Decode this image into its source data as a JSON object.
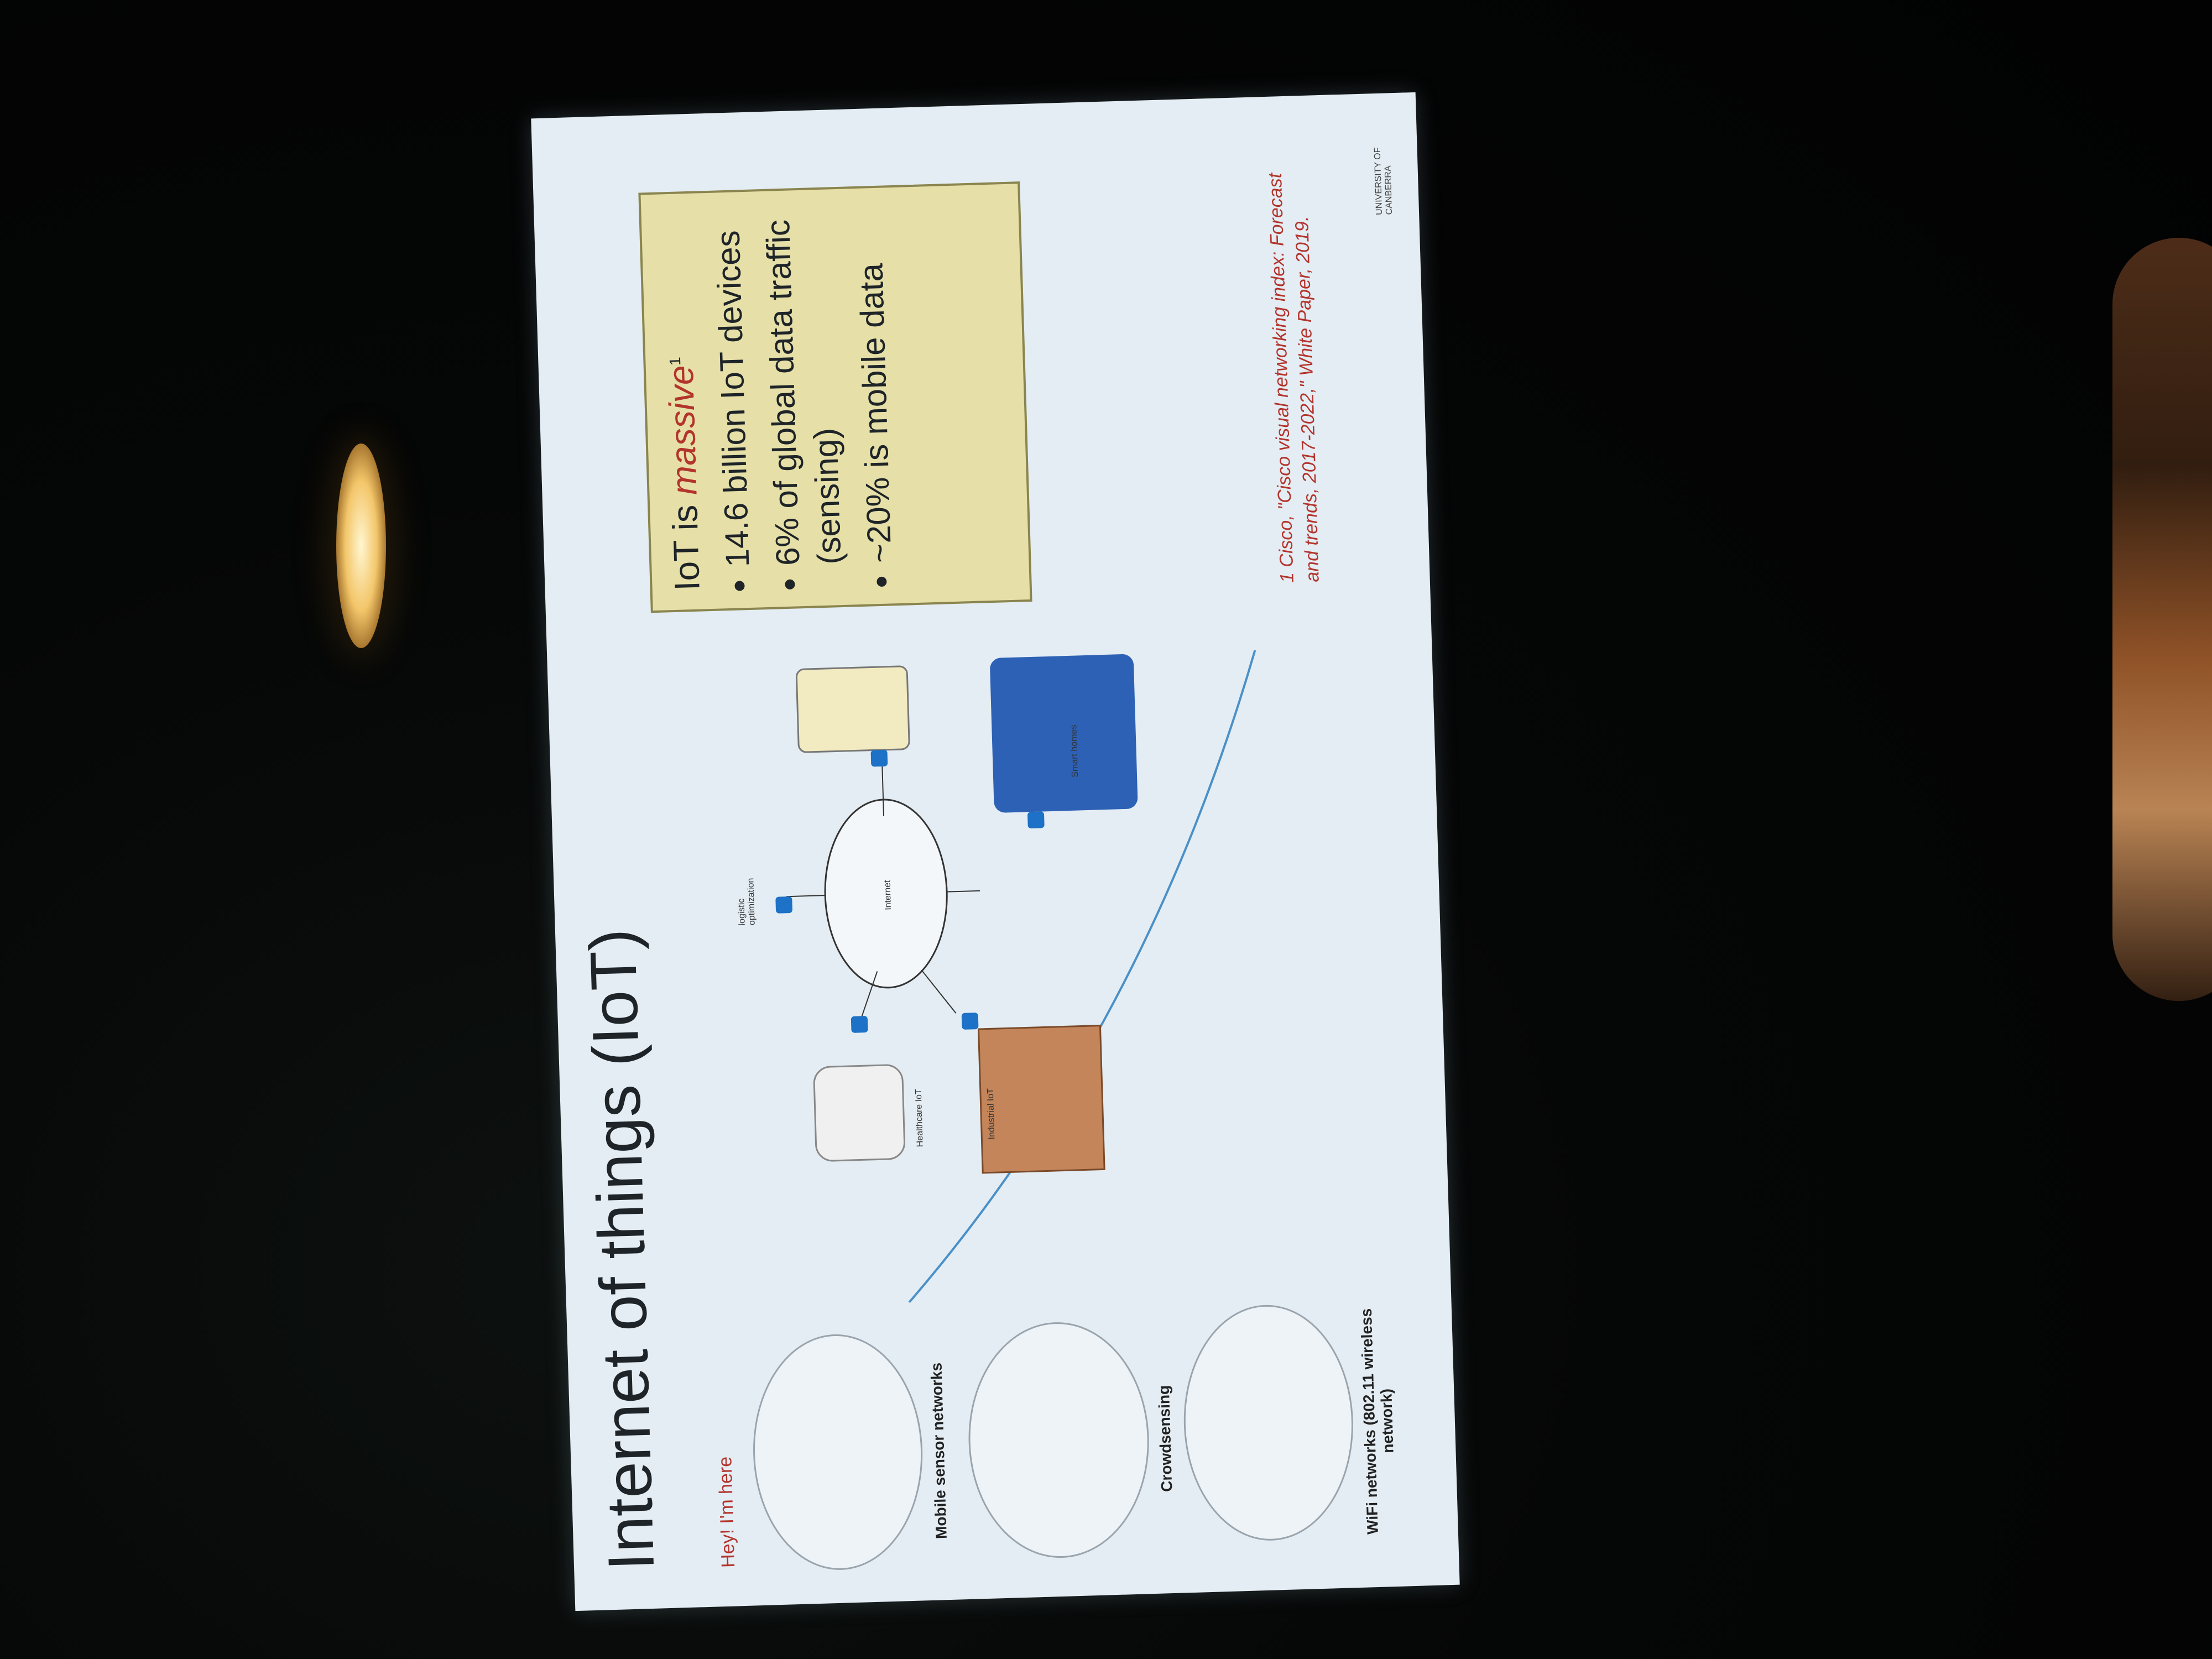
{
  "slide": {
    "title": "Internet of things (IoT)",
    "hey_text": "Hey! I'm here",
    "callout": {
      "heading_prefix": "IoT is ",
      "heading_emphasis": "massive",
      "heading_sup": "1",
      "bullets": [
        "14.6 billion IoT devices",
        "6% of global data traffic (sensing)",
        "~20% is mobile data"
      ]
    },
    "reference": "1 Cisco, \"Cisco visual networking index: Forecast and trends, 2017-2022,\" White Paper, 2019.",
    "diagram": {
      "mobile_sensor_networks": "Mobile sensor networks",
      "crowdsensing": "Crowdsensing",
      "wifi_networks": "WiFi networks (802.11 wireless network)",
      "healthcare_iot": "Healthcare IoT",
      "industrial_iot": "Industrial IoT",
      "logistic_optimization": "logistic optimization",
      "internet": "Internet",
      "smart_homes": "Smart homes"
    },
    "logo_text": "UNIVERSITY OF CANBERRA"
  },
  "colors": {
    "slide_bg": "#e4edf3",
    "accent_red": "#b3342c",
    "callout_bg": "#e6e0a8",
    "node_blue": "#1d71c6"
  }
}
